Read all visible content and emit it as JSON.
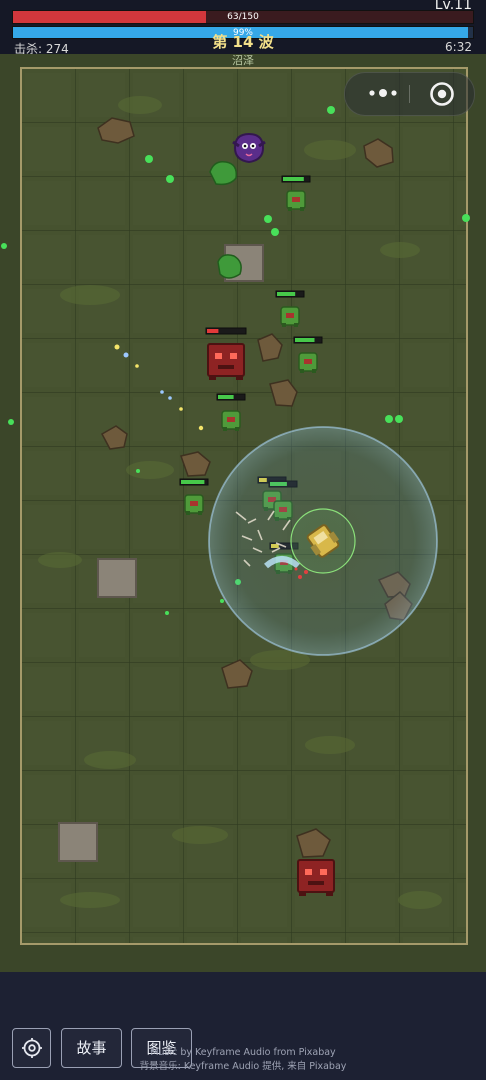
{
  "hud": {
    "level": "Lv.11",
    "hp_text": "63/150",
    "hp_fraction": 0.42,
    "xp_text": "99%",
    "xp_fraction": 0.99,
    "kills": "击杀: 274",
    "wave": "第 14 波",
    "timer": "6:32",
    "biome": "沼泽"
  },
  "menu_capsule": {
    "more_icon": "more-dots-icon",
    "close_icon": "target-circle-icon"
  },
  "buttons": {
    "settings_icon": "gear-icon",
    "story": "故事",
    "codex": "图鉴"
  },
  "credits": {
    "line1": "Music by Keyframe Audio from Pixabay",
    "line2": "背景音乐: Keyframe Audio 提供, 来自 Pixabay"
  },
  "colors": {
    "hp": "#d2373c",
    "xp": "#35a8e8",
    "wave": "#f3e08a",
    "enemy_green": "#4f9a3a",
    "enemy_red": "#9e2a2a",
    "enemy_purple": "#5a2d8a",
    "player": "#d8b84a",
    "aura": "#6aa6d8"
  },
  "enemies": {
    "green_health": [
      0.8,
      0.7,
      0.75,
      0.6,
      0.9,
      0.3,
      0.65,
      0.3
    ],
    "red_health": [
      0.3,
      1.0
    ]
  }
}
